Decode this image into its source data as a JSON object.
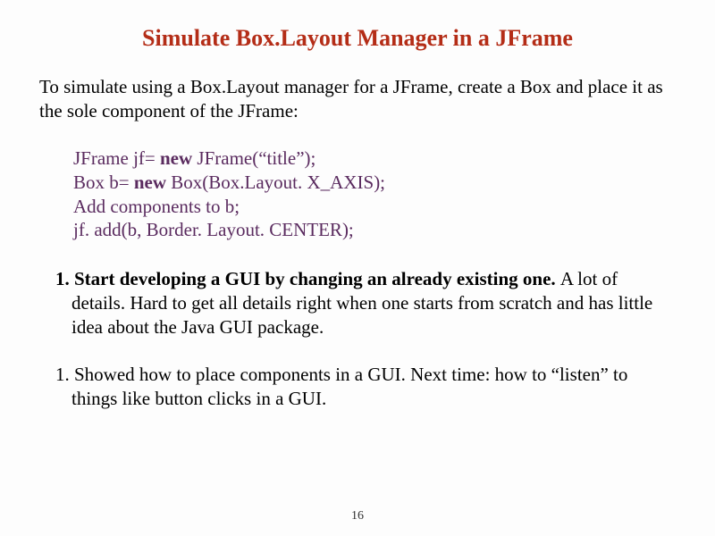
{
  "title": "Simulate Box.Layout Manager in a JFrame",
  "intro": "To simulate using a Box.Layout manager for a JFrame, create a Box and place it as the sole component of the JFrame:",
  "code": {
    "line1_pre": "JFrame jf= ",
    "line1_kw": "new",
    "line1_post": " JFrame(“title”);",
    "line2_pre": "Box b= ",
    "line2_kw": "new",
    "line2_post": " Box(Box.Layout. X_AXIS);",
    "line3": "Add components to b;",
    "line4": "jf. add(b, Border. Layout. CENTER);"
  },
  "para1_lead": "1. Start developing a GUI by changing an already existing one. ",
  "para1_rest": "A lot of details. Hard to get all details right when one starts from scratch and has little idea about the Java GUI package.",
  "para2": "1. Showed how to place components in a GUI. Next time: how to “listen” to things like button clicks in a GUI.",
  "page": "16"
}
